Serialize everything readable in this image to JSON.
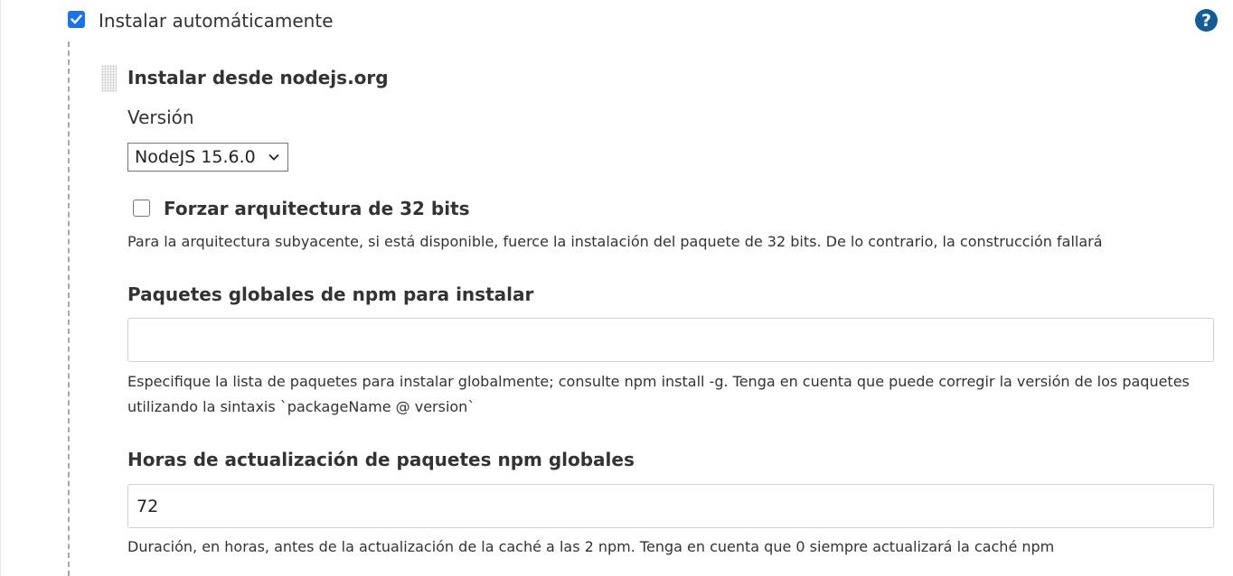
{
  "auto_install": {
    "checked": true,
    "label": "Instalar automáticamente",
    "help_glyph": "?"
  },
  "installer": {
    "title": "Instalar desde nodejs.org",
    "version_label": "Versión",
    "version_selected": "NodeJS 15.6.0",
    "force32": {
      "checked": false,
      "label": "Forzar arquitectura de 32 bits",
      "help": "Para la arquitectura subyacente, si está disponible, fuerce la instalación del paquete de 32 bits. De lo contrario, la construcción fallará"
    },
    "global_packages": {
      "label": "Paquetes globales de npm para instalar",
      "value": "",
      "help": "Especifique la lista de paquetes para instalar globalmente; consulte npm install -g. Tenga en cuenta que puede corregir la versión de los paquetes utilizando la sintaxis `packageName @ version`"
    },
    "refresh_hours": {
      "label": "Horas de actualización de paquetes npm globales",
      "value": "72",
      "help": "Duración, en horas, antes de la actualización de la caché a las 2 npm. Tenga en cuenta que 0 siempre actualizará la caché npm"
    }
  },
  "icons": {
    "help": "question-mark-circle-icon",
    "drag": "drag-handle-icon",
    "dropdown": "chevron-down-icon",
    "check": "checkmark-icon"
  },
  "colors": {
    "checkbox_checked": "#1a73e8",
    "help_icon": "#125c9c",
    "text": "#333333"
  }
}
